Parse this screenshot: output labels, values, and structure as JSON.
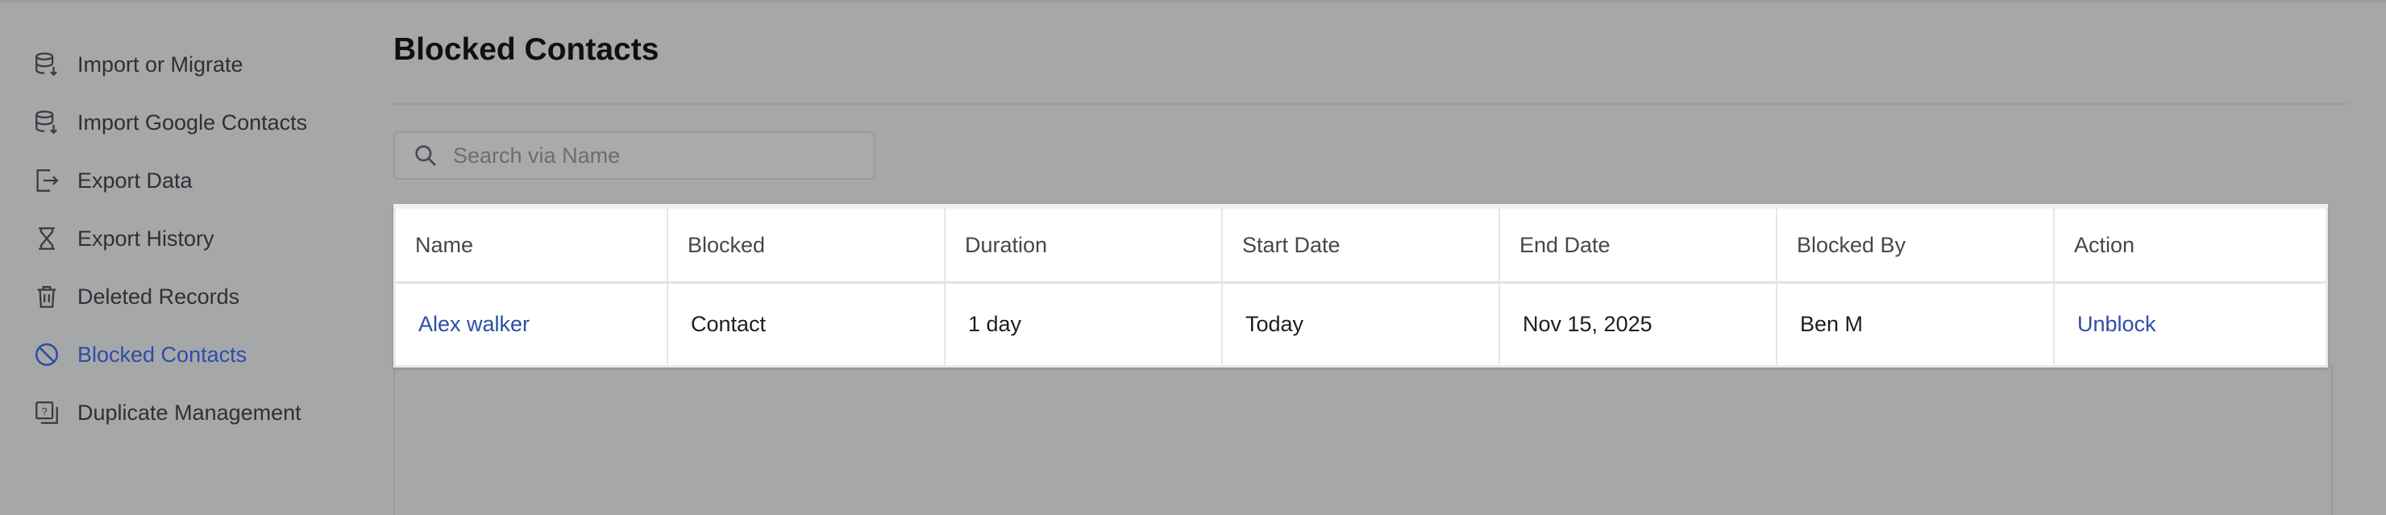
{
  "sidebar": {
    "items": [
      {
        "label": "Import or Migrate",
        "icon": "database-import-icon",
        "active": false
      },
      {
        "label": "Import Google Contacts",
        "icon": "database-import-icon",
        "active": false
      },
      {
        "label": "Export Data",
        "icon": "export-icon",
        "active": false
      },
      {
        "label": "Export History",
        "icon": "hourglass-icon",
        "active": false
      },
      {
        "label": "Deleted Records",
        "icon": "trash-icon",
        "active": false
      },
      {
        "label": "Blocked Contacts",
        "icon": "block-icon",
        "active": true
      },
      {
        "label": "Duplicate Management",
        "icon": "duplicate-icon",
        "active": false
      }
    ]
  },
  "main": {
    "title": "Blocked Contacts",
    "search": {
      "placeholder": "Search via Name",
      "value": ""
    },
    "table": {
      "columns": [
        "Name",
        "Blocked",
        "Duration",
        "Start Date",
        "End Date",
        "Blocked By",
        "Action"
      ],
      "rows": [
        {
          "name": "Alex walker",
          "blocked": "Contact",
          "duration": "1 day",
          "start_date": "Today",
          "end_date": "Nov 15, 2025",
          "blocked_by": "Ben M",
          "action": "Unblock"
        }
      ]
    }
  },
  "colors": {
    "accent": "#2c4ea6",
    "overlay_background": "#a6a7a9",
    "table_background": "#ffffff"
  }
}
